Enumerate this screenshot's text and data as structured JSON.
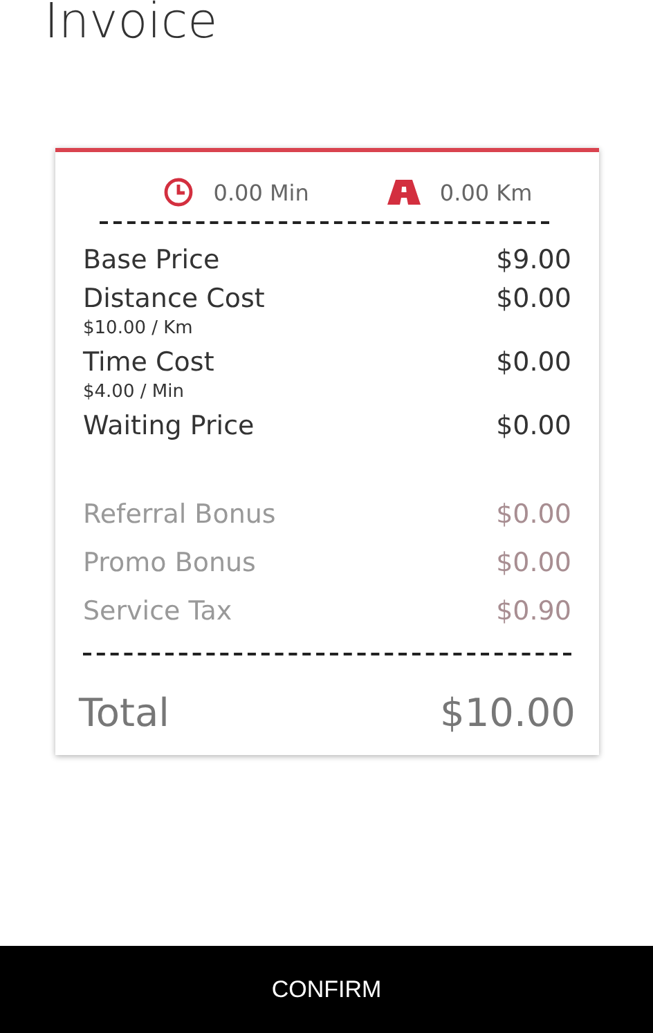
{
  "title": "Invoice",
  "stats": [
    {
      "kind": "time",
      "value": "0.00 Min"
    },
    {
      "kind": "distance",
      "value": "0.00 Km"
    }
  ],
  "rows": [
    {
      "kind": "main",
      "label": "Base Price",
      "amount": "$9.00"
    },
    {
      "kind": "main",
      "label": "Distance Cost",
      "amount": "$0.00",
      "rate": "$10.00 / Km"
    },
    {
      "kind": "main",
      "label": "Time Cost",
      "amount": "$0.00",
      "rate": "$4.00 / Min"
    },
    {
      "kind": "main",
      "label": "Waiting Price",
      "amount": "$0.00"
    },
    {
      "kind": "muted",
      "label": "Referral Bonus",
      "amount": "$0.00"
    },
    {
      "kind": "muted",
      "label": "Promo Bonus",
      "amount": "$0.00"
    },
    {
      "kind": "muted",
      "label": "Service Tax",
      "amount": "$0.90"
    }
  ],
  "total": {
    "label": "Total",
    "amount": "$10.00"
  },
  "button": "CONFIRM"
}
